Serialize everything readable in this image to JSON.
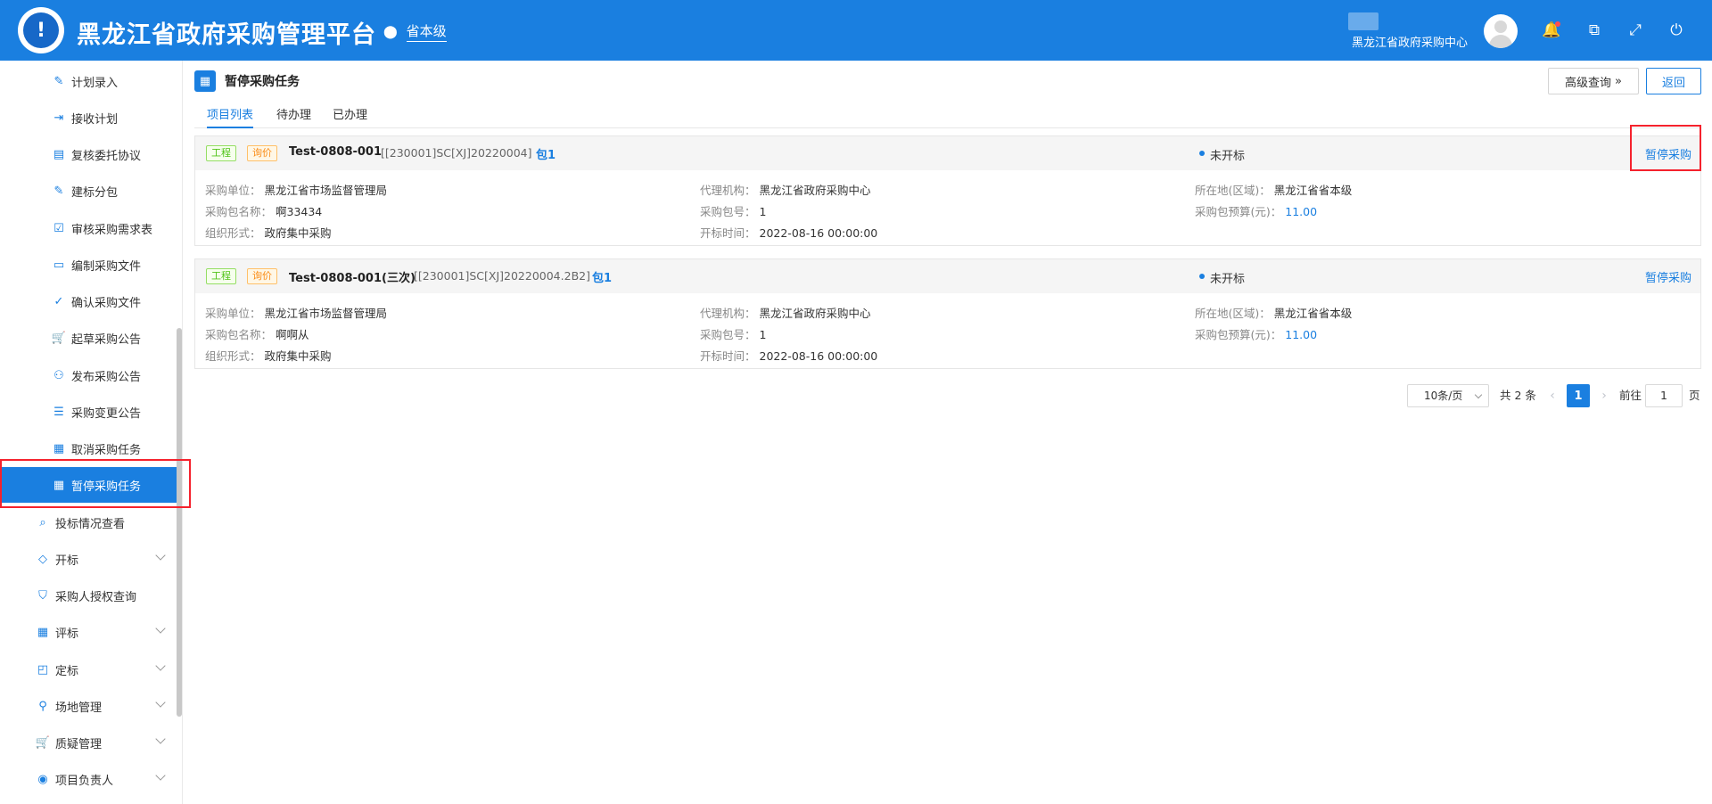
{
  "header": {
    "title": "黑龙江省政府采购管理平台",
    "region": "省本级",
    "user_org": "黑龙江省政府采购中心",
    "colors": {
      "primary": "#1a7fe0",
      "highlight": "#f5222d"
    }
  },
  "sidebar": {
    "items": [
      {
        "label": "计划录入",
        "icon": "edit-icon"
      },
      {
        "label": "接收计划",
        "icon": "import-icon"
      },
      {
        "label": "复核委托协议",
        "icon": "document-icon"
      },
      {
        "label": "建标分包",
        "icon": "edit-icon"
      },
      {
        "label": "审核采购需求表",
        "icon": "clipboard-icon"
      },
      {
        "label": "编制采购文件",
        "icon": "file-icon"
      },
      {
        "label": "确认采购文件",
        "icon": "file-check-icon"
      },
      {
        "label": "起草采购公告",
        "icon": "cart-icon"
      },
      {
        "label": "发布采购公告",
        "icon": "users-icon"
      },
      {
        "label": "采购变更公告",
        "icon": "list-icon"
      },
      {
        "label": "取消采购任务",
        "icon": "file-x-icon"
      },
      {
        "label": "暂停采购任务",
        "icon": "file-x-icon"
      }
    ],
    "groups": [
      {
        "label": "投标情况查看",
        "icon": "search-doc-icon"
      },
      {
        "label": "开标",
        "icon": "diamond-icon"
      },
      {
        "label": "采购人授权查询",
        "icon": "shield-icon"
      },
      {
        "label": "评标",
        "icon": "table-icon"
      },
      {
        "label": "定标",
        "icon": "award-icon"
      },
      {
        "label": "场地管理",
        "icon": "user-icon"
      },
      {
        "label": "质疑管理",
        "icon": "cart-icon"
      },
      {
        "label": "项目负责人",
        "icon": "person-circle-icon"
      }
    ]
  },
  "page": {
    "title": "暂停采购任务",
    "advanced_query": "高级查询",
    "back": "返回",
    "tabs": [
      "项目列表",
      "待办理",
      "已办理"
    ]
  },
  "projects": [
    {
      "tag1": "工程",
      "tag2": "询价",
      "name": "Test-0808-001",
      "code": "[[230001]SC[XJ]20220004]",
      "package": "包1",
      "status": "未开标",
      "action": "暂停采购",
      "k_unit": "采购单位：",
      "unit": "黑龙江省市场监督管理局",
      "k_pkgname": "采购包名称：",
      "pkgname": "啊33434",
      "k_form": "组织形式：",
      "form": "政府集中采购",
      "k_agency": "代理机构：",
      "agency": "黑龙江省政府采购中心",
      "k_pkgno": "采购包号：",
      "pkgno": "1",
      "k_open": "开标时间：",
      "open": "2022-08-16 00:00:00",
      "k_loc": "所在地(区域)：",
      "loc": "黑龙江省省本级",
      "k_budget": "采购包预算(元)：",
      "budget": "11.00"
    },
    {
      "tag1": "工程",
      "tag2": "询价",
      "name": "Test-0808-001(三次)",
      "code": "[[230001]SC[XJ]20220004.2B2]",
      "package": "包1",
      "status": "未开标",
      "action": "暂停采购",
      "k_unit": "采购单位：",
      "unit": "黑龙江省市场监督管理局",
      "k_pkgname": "采购包名称：",
      "pkgname": "啊啊从",
      "k_form": "组织形式：",
      "form": "政府集中采购",
      "k_agency": "代理机构：",
      "agency": "黑龙江省政府采购中心",
      "k_pkgno": "采购包号：",
      "pkgno": "1",
      "k_open": "开标时间：",
      "open": "2022-08-16 00:00:00",
      "k_loc": "所在地(区域)：",
      "loc": "黑龙江省省本级",
      "k_budget": "采购包预算(元)：",
      "budget": "11.00"
    }
  ],
  "pagination": {
    "page_size": "10条/页",
    "total": "共 2 条",
    "current": "1",
    "goto_label": "前往",
    "goto_value": "1",
    "page_suffix": "页"
  }
}
